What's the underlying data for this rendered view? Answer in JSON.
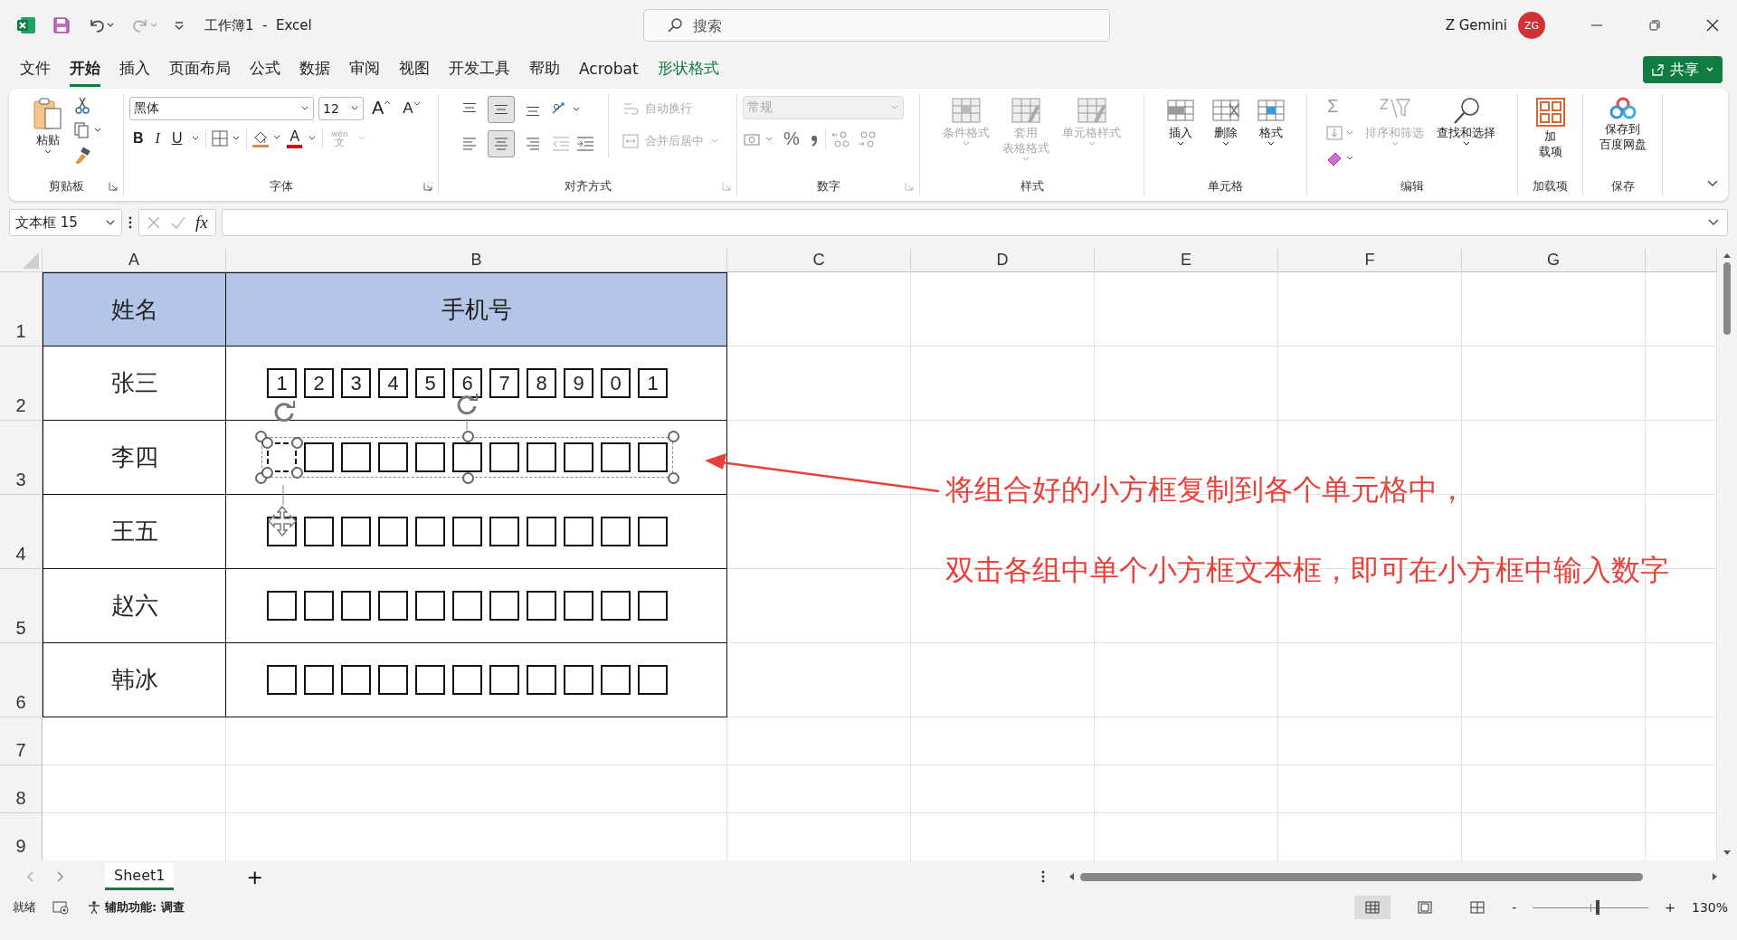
{
  "title_bar": {
    "document_title": "工作簿1  -  Excel",
    "search": {
      "placeholder": "搜索"
    },
    "user_name": "Z Gemini",
    "avatar_initials": "ZG"
  },
  "menu_tabs": [
    {
      "label": "文件",
      "selected": false,
      "kind": "normal"
    },
    {
      "label": "开始",
      "selected": true,
      "kind": "normal"
    },
    {
      "label": "插入",
      "selected": false,
      "kind": "normal"
    },
    {
      "label": "页面布局",
      "selected": false,
      "kind": "normal"
    },
    {
      "label": "公式",
      "selected": false,
      "kind": "normal"
    },
    {
      "label": "数据",
      "selected": false,
      "kind": "normal"
    },
    {
      "label": "审阅",
      "selected": false,
      "kind": "normal"
    },
    {
      "label": "视图",
      "selected": false,
      "kind": "normal"
    },
    {
      "label": "开发工具",
      "selected": false,
      "kind": "normal"
    },
    {
      "label": "帮助",
      "selected": false,
      "kind": "normal"
    },
    {
      "label": "Acrobat",
      "selected": false,
      "kind": "normal"
    },
    {
      "label": "形状格式",
      "selected": false,
      "kind": "contextual"
    }
  ],
  "share_button": "共享",
  "ribbon": {
    "clipboard": {
      "label": "剪贴板",
      "paste": "粘贴"
    },
    "font": {
      "label": "字体",
      "font_name": "黑体",
      "font_size": "12",
      "grow": "A",
      "shrink": "A",
      "bold": "B",
      "italic": "I",
      "underline": "U",
      "font_color": "A",
      "phonetic_top": "wén",
      "phonetic_bottom": "文"
    },
    "alignment": {
      "label": "对齐方式",
      "vertical": [
        {
          "selected": false
        },
        {
          "selected": true
        },
        {
          "selected": false
        }
      ],
      "horizontal": [
        {
          "selected": false
        },
        {
          "selected": true
        },
        {
          "selected": false
        }
      ],
      "wrap_text": {
        "label": "自动换行",
        "disabled": true
      },
      "merge_center": {
        "label": "合并后居中",
        "disabled": true
      }
    },
    "number": {
      "label": "数字",
      "format": {
        "value": "常规",
        "disabled": true
      },
      "percent": "%"
    },
    "styles": {
      "label": "样式",
      "items": [
        {
          "lines": [
            "条件格式"
          ],
          "disabled": true
        },
        {
          "lines": [
            "套用",
            "表格格式"
          ],
          "disabled": true
        },
        {
          "lines": [
            "单元格样式"
          ],
          "disabled": true
        }
      ]
    },
    "cells": {
      "label": "单元格",
      "items": [
        {
          "lines": [
            "插入"
          ],
          "disabled": false
        },
        {
          "lines": [
            "删除"
          ],
          "disabled": false
        },
        {
          "lines": [
            "格式"
          ],
          "disabled": false
        }
      ]
    },
    "editing": {
      "label": "编辑",
      "sum": "Σ",
      "sort_filter": {
        "label": "排序和筛选",
        "disabled": true
      },
      "find_select": {
        "label": "查找和选择",
        "disabled": false
      }
    },
    "addins": {
      "label": "加载项",
      "lines": [
        "加",
        "载项"
      ]
    },
    "save": {
      "label": "保存",
      "lines": [
        "保存到",
        "百度网盘"
      ]
    }
  },
  "formula_bar": {
    "name_box": "文本框 15",
    "fx": "fx"
  },
  "columns": [
    "A",
    "B",
    "C",
    "D",
    "E",
    "F",
    "G"
  ],
  "rows": [
    {
      "number": "1",
      "kind": "header",
      "cells": [
        "姓名",
        "手机号"
      ]
    },
    {
      "number": "2",
      "kind": "boxes",
      "name": "张三",
      "group_selected": false,
      "boxes": [
        {
          "digit": "1",
          "selected": false
        },
        {
          "digit": "2",
          "selected": false
        },
        {
          "digit": "3",
          "selected": false
        },
        {
          "digit": "4",
          "selected": false
        },
        {
          "digit": "5",
          "selected": false
        },
        {
          "digit": "6",
          "selected": false
        },
        {
          "digit": "7",
          "selected": false
        },
        {
          "digit": "8",
          "selected": false
        },
        {
          "digit": "9",
          "selected": false
        },
        {
          "digit": "0",
          "selected": false
        },
        {
          "digit": "1",
          "selected": false
        }
      ]
    },
    {
      "number": "3",
      "kind": "boxes",
      "name": "李四",
      "group_selected": true,
      "boxes": [
        {
          "selected": true
        },
        {
          "selected": false
        },
        {
          "selected": false
        },
        {
          "selected": false
        },
        {
          "selected": false
        },
        {
          "selected": false
        },
        {
          "selected": false
        },
        {
          "selected": false
        },
        {
          "selected": false
        },
        {
          "selected": false
        },
        {
          "selected": false
        }
      ]
    },
    {
      "number": "4",
      "kind": "boxes",
      "name": "王五",
      "group_selected": false,
      "boxes": [
        {
          "selected": false
        },
        {
          "selected": false
        },
        {
          "selected": false
        },
        {
          "selected": false
        },
        {
          "selected": false
        },
        {
          "selected": false
        },
        {
          "selected": false
        },
        {
          "selected": false
        },
        {
          "selected": false
        },
        {
          "selected": false
        },
        {
          "selected": false
        }
      ]
    },
    {
      "number": "5",
      "kind": "boxes",
      "name": "赵六",
      "group_selected": false,
      "boxes": [
        {
          "selected": false
        },
        {
          "selected": false
        },
        {
          "selected": false
        },
        {
          "selected": false
        },
        {
          "selected": false
        },
        {
          "selected": false
        },
        {
          "selected": false
        },
        {
          "selected": false
        },
        {
          "selected": false
        },
        {
          "selected": false
        },
        {
          "selected": false
        }
      ]
    },
    {
      "number": "6",
      "kind": "boxes",
      "name": "韩冰",
      "group_selected": false,
      "boxes": [
        {
          "selected": false
        },
        {
          "selected": false
        },
        {
          "selected": false
        },
        {
          "selected": false
        },
        {
          "selected": false
        },
        {
          "selected": false
        },
        {
          "selected": false
        },
        {
          "selected": false
        },
        {
          "selected": false
        },
        {
          "selected": false
        },
        {
          "selected": false
        }
      ]
    },
    {
      "number": "7",
      "kind": "blank"
    },
    {
      "number": "8",
      "kind": "blank"
    },
    {
      "number": "9",
      "kind": "blank"
    }
  ],
  "annotation": [
    "将组合好的小方框复制到各个单元格中，",
    "双击各组中单个小方框文本框，即可在小方框中输入数字"
  ],
  "sheet_tabs": [
    {
      "label": "Sheet1",
      "selected": true
    }
  ],
  "add_sheet": "+",
  "status_bar": {
    "ready": "就绪",
    "accessibility": "辅助功能: 调查",
    "views": [
      {
        "selected": true
      },
      {
        "selected": false
      },
      {
        "selected": false
      }
    ],
    "zoom_out": "-",
    "zoom_in": "+",
    "zoom": {
      "level": 0.56
    },
    "zoom_reading": "130%"
  }
}
